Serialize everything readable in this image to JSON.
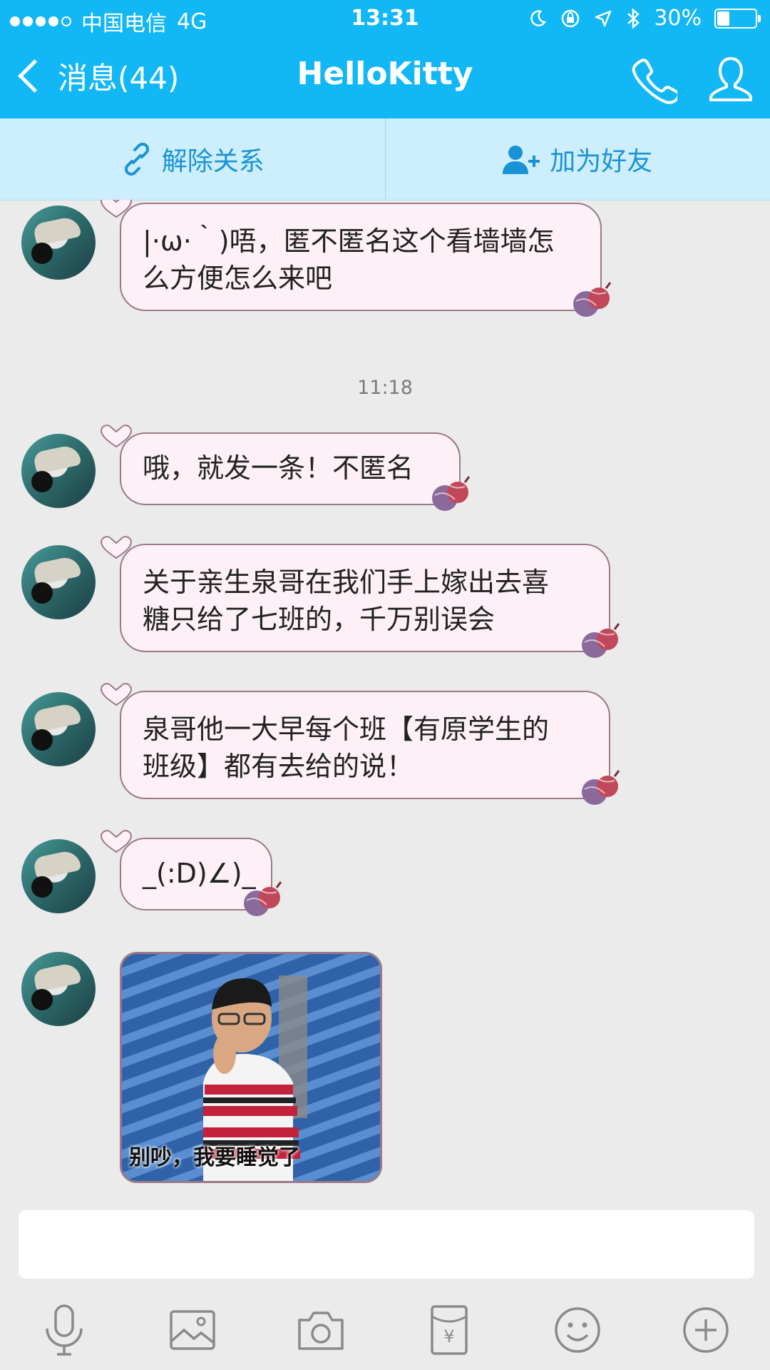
{
  "status_bar": {
    "carrier": "中国电信",
    "network": "4G",
    "time": "13:31",
    "battery": "30%",
    "battery_level": 0.3
  },
  "nav": {
    "back_label": "消息(44)",
    "title": "HelloKitty",
    "icons": [
      "phone-icon",
      "profile-icon"
    ]
  },
  "relation_bar": {
    "unlink_label": "解除关系",
    "add_friend_label": "加为好友"
  },
  "messages": [
    {
      "type": "text",
      "text": "|·ω·｀)唔，匿不匿名这个看墙墙怎\n么方便怎么来吧"
    },
    {
      "type": "timestamp",
      "text": "11:18"
    },
    {
      "type": "text",
      "text": "哦，就发一条！不匿名"
    },
    {
      "type": "text",
      "text": "关于亲生泉哥在我们手上嫁出去喜\n糖只给了七班的，千万别误会"
    },
    {
      "type": "text",
      "text": "泉哥他一大早每个班【有原学生的\n班级】都有去给的说！"
    },
    {
      "type": "text",
      "text": "_(:D)∠)_"
    },
    {
      "type": "image",
      "caption": "别吵，我要睡觉了"
    }
  ],
  "input": {
    "placeholder": "",
    "value": ""
  },
  "toolbar": [
    "mic-icon",
    "image-icon",
    "camera-icon",
    "red-packet-icon",
    "emoji-icon",
    "plus-icon"
  ],
  "colors": {
    "header": "#12b7f5",
    "relation_bar": "#cdeefc",
    "bubble": "#fdf1f7",
    "bubble_border": "#9a7a86",
    "background": "#ebebeb"
  }
}
